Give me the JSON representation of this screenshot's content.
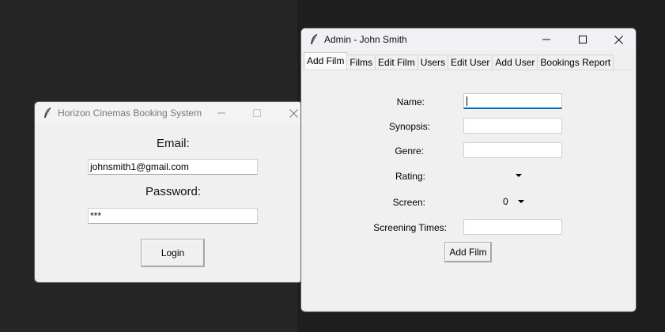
{
  "login_window": {
    "title": "Horizon Cinemas Booking System",
    "email_label": "Email:",
    "email_value": "johnsmith1@gmail.com",
    "password_label": "Password:",
    "password_value": "***",
    "login_button": "Login"
  },
  "admin_window": {
    "title": "Admin - John Smith",
    "tabs": [
      {
        "label": "Add Film"
      },
      {
        "label": "Films"
      },
      {
        "label": "Edit Film"
      },
      {
        "label": "Users"
      },
      {
        "label": "Edit User"
      },
      {
        "label": "Add User"
      },
      {
        "label": "Bookings Report"
      }
    ],
    "form": {
      "name_label": "Name:",
      "synopsis_label": "Synopsis:",
      "genre_label": "Genre:",
      "rating_label": "Rating:",
      "rating_value": "",
      "screen_label": "Screen:",
      "screen_value": "0",
      "screening_times_label": "Screening Times:",
      "add_film_button": "Add Film"
    }
  },
  "icons": {
    "app_icon": "feather-icon",
    "minimize": "minimize-icon",
    "maximize": "maximize-icon",
    "close": "close-icon"
  }
}
